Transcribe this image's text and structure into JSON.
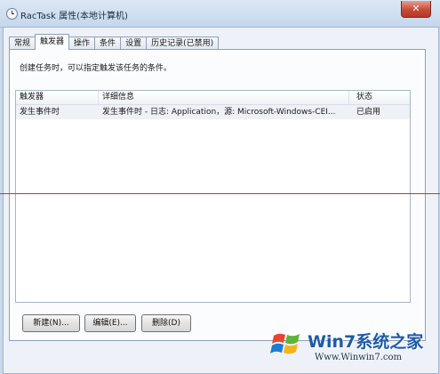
{
  "window": {
    "title": "RacTask 属性(本地计算机)",
    "close_label": "✕"
  },
  "tabs": [
    {
      "label": "常规"
    },
    {
      "label": "触发器",
      "active": true
    },
    {
      "label": "操作"
    },
    {
      "label": "条件"
    },
    {
      "label": "设置"
    },
    {
      "label": "历史记录(已禁用)"
    }
  ],
  "panel": {
    "description": "创建任务时，可以指定触发该任务的条件。"
  },
  "table": {
    "columns": [
      "触发器",
      "详细信息",
      "状态"
    ],
    "rows": [
      {
        "trigger": "发生事件时",
        "details": "发生事件时 - 日志: Application，源: Microsoft-Windows-CEI...",
        "status": "已启用"
      }
    ]
  },
  "buttons": {
    "new": "新建(N)...",
    "edit": "编辑(E)...",
    "delete": "删除(D)"
  },
  "watermark": {
    "brand": "Win7系统之家",
    "url": "Www.Winwin7.com"
  }
}
